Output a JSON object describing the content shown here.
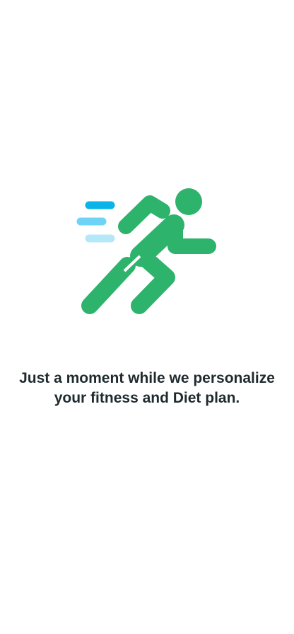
{
  "screen": {
    "illustration_icon": "running-person-icon",
    "message": "Just a moment while we personalize your fitness and Diet plan."
  },
  "colors": {
    "runner_green": "#2db36b",
    "speed_line_dark": "#0ab4e8",
    "speed_line_mid": "#6fd3f6",
    "speed_line_light": "#b4e8f9",
    "text": "#1f2a2e",
    "background": "#ffffff"
  }
}
